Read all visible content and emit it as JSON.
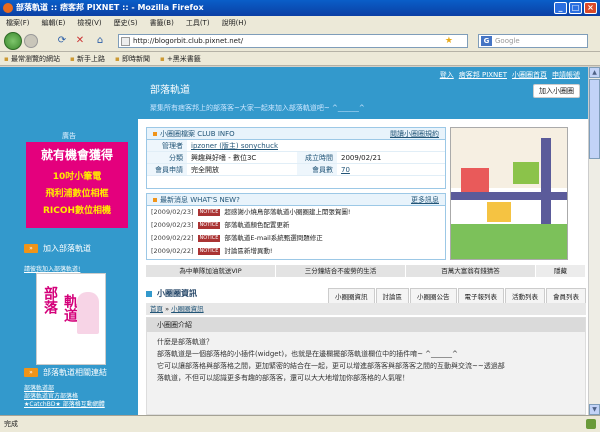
{
  "window": {
    "title": "部落軌道 :: 痞客邦 PIXNET :: - Mozilla Firefox"
  },
  "menu": [
    "檔案(F)",
    "編輯(E)",
    "檢視(V)",
    "歷史(S)",
    "書籤(B)",
    "工具(T)",
    "說明(H)"
  ],
  "nav": {
    "url": "http://blogorbit.club.pixnet.net/",
    "search_placeholder": "Google"
  },
  "bookmarks": [
    "最常瀏覽的網站",
    "新手上路",
    "即時新聞",
    "+黑米書籤"
  ],
  "status": "完成",
  "header": {
    "title": "部落軌道",
    "subtitle": "聚集所有痞客邦上的部落客~大家一起來加入部落軌道吧~ ^______^",
    "links": [
      "登入",
      "痞客邦 PIXNET",
      "小圈圈首頁",
      "申請帳號"
    ],
    "add_button": "加入小圈圈"
  },
  "left": {
    "ad_label": "廣告",
    "ad_lines": [
      "就有機會獲得",
      "10吋小筆電",
      "飛利浦數位相框",
      "RICOH數位相機"
    ],
    "join_title": "加入部落軌道",
    "join_link": "請彼我加入部落軌道!",
    "badge_text1": "部落",
    "badge_text2": "軌道",
    "related_title": "部落軌道相關連結",
    "related_links": [
      "部落軌道部",
      "部落軌道官方部落格",
      "★CatchBD★ 部落格互動網體"
    ]
  },
  "club": {
    "head": "小圈圈檔案 CLUB INFO",
    "more": "閱讀小圈圈規約",
    "rows": [
      {
        "k": "管理者",
        "v": "ipzoner (版主) sonychuck",
        "k2": "",
        "v2": ""
      },
      {
        "k": "分類",
        "v": "興趣與好嗜 - 數位3C",
        "k2": "成立時間",
        "v2": "2009/02/21"
      },
      {
        "k": "會員申請",
        "v": "完全開放",
        "k2": "會員數",
        "v2": "70"
      }
    ]
  },
  "news": {
    "head": "最新消息 WHAT'S NEW?",
    "more": "更多訊息",
    "tag": "NOTICE",
    "items": [
      {
        "date": "[2009/02/23]",
        "text": "超感謝小燒鳥部落軌道小圈圈建上開張賀圖!"
      },
      {
        "date": "[2009/02/23]",
        "text": "部落軌道顏色配置更新"
      },
      {
        "date": "[2009/02/22]",
        "text": "部落軌道E-mail系統甄選問題修正"
      },
      {
        "date": "[2009/02/22]",
        "text": "討論區新增異動!"
      }
    ]
  },
  "promo_tabs": [
    "為中華隊加油就送VIP",
    "三分鐘結合不疲勞的生活",
    "百萬大富翁有錢猜答",
    "隱藏"
  ],
  "section": {
    "title": "小圈圈資訊",
    "tabs": [
      "小圈圈資訊",
      "討論區",
      "小圈圈公告",
      "電子報列表",
      "活動列表",
      "會員列表"
    ]
  },
  "breadcrumb": [
    "首頁",
    "小圈圈資訊"
  ],
  "article": {
    "head": "小圈圈介紹",
    "lines": [
      "什麼是部落軌道？",
      "部落軌道是一個部落格的小插件(widget)，也就是在邊欄擺部落軌道欄位中的插件唷~ ^______^",
      "它可以讓部落格與部落格之間，更加緊密的結合在一起，更可以增進部落客與部落客之間的互動與交流~~透過部",
      "落軌道，不但可以認識更多有趣的部落客，還可以大大地增加你部落格的人氣喔！"
    ]
  }
}
